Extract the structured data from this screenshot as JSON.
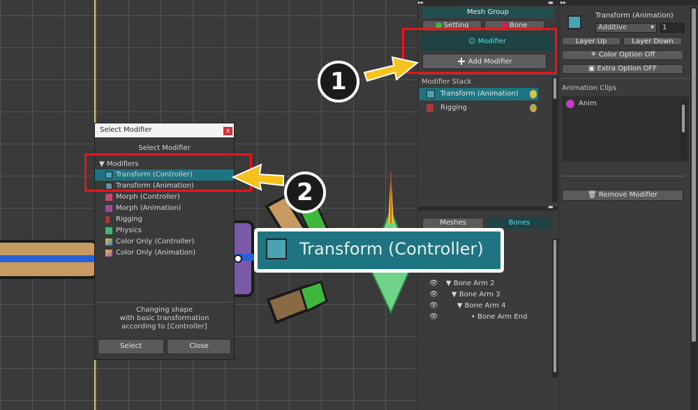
{
  "mesh_group": {
    "title": "Mesh Group",
    "tab_setting": "Setting",
    "tab_bone": "Bone",
    "tab_modifier": "Modifier",
    "add_modifier": "Add Modifier",
    "modifier_stack_label": "Modifier Stack",
    "stack": [
      "Transform (Animation)",
      "Rigging"
    ],
    "tab_meshes": "Meshes",
    "tab_bones": "Bones",
    "bones": [
      "Bone Arm 2",
      "Bone Arm 3",
      "Bone Arm 4",
      "Bone Arm End"
    ]
  },
  "right": {
    "title": "Transform (Animation)",
    "blend_mode": "Additive",
    "layer_value": "1",
    "layer_up": "Layer Up",
    "layer_down": "Layer Down",
    "color_option": "Color Option Off",
    "extra_option": "Extra Option OFF",
    "anim_clips_label": "Animation Clips",
    "anim_clip": "Anim",
    "remove_modifier": "Remove Modifier"
  },
  "dialog": {
    "title": "Select Modifier",
    "close_x": "x",
    "heading": "Select Modifier",
    "tree_root": "Modifiers",
    "items": [
      "Transform (Controller)",
      "Transform (Animation)",
      "Morph (Controller)",
      "Morph (Animation)",
      "Rigging",
      "Physics",
      "Color Only (Controller)",
      "Color Only (Animation)"
    ],
    "desc_line1": "Changing shape",
    "desc_line2": "with basic transformation",
    "desc_line3": "according to [Controller]",
    "select_btn": "Select",
    "close_btn": "Close"
  },
  "callouts": {
    "num1": "1",
    "num2": "2",
    "zoom_label": "Transform (Controller)"
  },
  "colors": {
    "accent_teal": "#1e7480",
    "callout_red": "#e8151b",
    "arrow_yellow": "#f6c31c"
  }
}
